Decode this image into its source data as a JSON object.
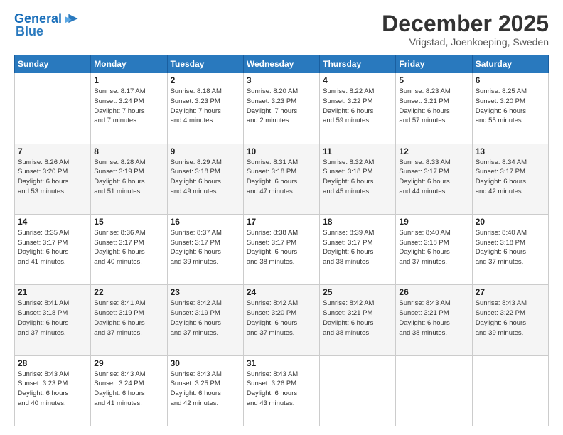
{
  "header": {
    "logo_line1": "General",
    "logo_line2": "Blue",
    "month_title": "December 2025",
    "location": "Vrigstad, Joenkoeping, Sweden"
  },
  "weekdays": [
    "Sunday",
    "Monday",
    "Tuesday",
    "Wednesday",
    "Thursday",
    "Friday",
    "Saturday"
  ],
  "weeks": [
    [
      {
        "day": "",
        "info": ""
      },
      {
        "day": "1",
        "info": "Sunrise: 8:17 AM\nSunset: 3:24 PM\nDaylight: 7 hours\nand 7 minutes."
      },
      {
        "day": "2",
        "info": "Sunrise: 8:18 AM\nSunset: 3:23 PM\nDaylight: 7 hours\nand 4 minutes."
      },
      {
        "day": "3",
        "info": "Sunrise: 8:20 AM\nSunset: 3:23 PM\nDaylight: 7 hours\nand 2 minutes."
      },
      {
        "day": "4",
        "info": "Sunrise: 8:22 AM\nSunset: 3:22 PM\nDaylight: 6 hours\nand 59 minutes."
      },
      {
        "day": "5",
        "info": "Sunrise: 8:23 AM\nSunset: 3:21 PM\nDaylight: 6 hours\nand 57 minutes."
      },
      {
        "day": "6",
        "info": "Sunrise: 8:25 AM\nSunset: 3:20 PM\nDaylight: 6 hours\nand 55 minutes."
      }
    ],
    [
      {
        "day": "7",
        "info": "Sunrise: 8:26 AM\nSunset: 3:20 PM\nDaylight: 6 hours\nand 53 minutes."
      },
      {
        "day": "8",
        "info": "Sunrise: 8:28 AM\nSunset: 3:19 PM\nDaylight: 6 hours\nand 51 minutes."
      },
      {
        "day": "9",
        "info": "Sunrise: 8:29 AM\nSunset: 3:18 PM\nDaylight: 6 hours\nand 49 minutes."
      },
      {
        "day": "10",
        "info": "Sunrise: 8:31 AM\nSunset: 3:18 PM\nDaylight: 6 hours\nand 47 minutes."
      },
      {
        "day": "11",
        "info": "Sunrise: 8:32 AM\nSunset: 3:18 PM\nDaylight: 6 hours\nand 45 minutes."
      },
      {
        "day": "12",
        "info": "Sunrise: 8:33 AM\nSunset: 3:17 PM\nDaylight: 6 hours\nand 44 minutes."
      },
      {
        "day": "13",
        "info": "Sunrise: 8:34 AM\nSunset: 3:17 PM\nDaylight: 6 hours\nand 42 minutes."
      }
    ],
    [
      {
        "day": "14",
        "info": "Sunrise: 8:35 AM\nSunset: 3:17 PM\nDaylight: 6 hours\nand 41 minutes."
      },
      {
        "day": "15",
        "info": "Sunrise: 8:36 AM\nSunset: 3:17 PM\nDaylight: 6 hours\nand 40 minutes."
      },
      {
        "day": "16",
        "info": "Sunrise: 8:37 AM\nSunset: 3:17 PM\nDaylight: 6 hours\nand 39 minutes."
      },
      {
        "day": "17",
        "info": "Sunrise: 8:38 AM\nSunset: 3:17 PM\nDaylight: 6 hours\nand 38 minutes."
      },
      {
        "day": "18",
        "info": "Sunrise: 8:39 AM\nSunset: 3:17 PM\nDaylight: 6 hours\nand 38 minutes."
      },
      {
        "day": "19",
        "info": "Sunrise: 8:40 AM\nSunset: 3:18 PM\nDaylight: 6 hours\nand 37 minutes."
      },
      {
        "day": "20",
        "info": "Sunrise: 8:40 AM\nSunset: 3:18 PM\nDaylight: 6 hours\nand 37 minutes."
      }
    ],
    [
      {
        "day": "21",
        "info": "Sunrise: 8:41 AM\nSunset: 3:18 PM\nDaylight: 6 hours\nand 37 minutes."
      },
      {
        "day": "22",
        "info": "Sunrise: 8:41 AM\nSunset: 3:19 PM\nDaylight: 6 hours\nand 37 minutes."
      },
      {
        "day": "23",
        "info": "Sunrise: 8:42 AM\nSunset: 3:19 PM\nDaylight: 6 hours\nand 37 minutes."
      },
      {
        "day": "24",
        "info": "Sunrise: 8:42 AM\nSunset: 3:20 PM\nDaylight: 6 hours\nand 37 minutes."
      },
      {
        "day": "25",
        "info": "Sunrise: 8:42 AM\nSunset: 3:21 PM\nDaylight: 6 hours\nand 38 minutes."
      },
      {
        "day": "26",
        "info": "Sunrise: 8:43 AM\nSunset: 3:21 PM\nDaylight: 6 hours\nand 38 minutes."
      },
      {
        "day": "27",
        "info": "Sunrise: 8:43 AM\nSunset: 3:22 PM\nDaylight: 6 hours\nand 39 minutes."
      }
    ],
    [
      {
        "day": "28",
        "info": "Sunrise: 8:43 AM\nSunset: 3:23 PM\nDaylight: 6 hours\nand 40 minutes."
      },
      {
        "day": "29",
        "info": "Sunrise: 8:43 AM\nSunset: 3:24 PM\nDaylight: 6 hours\nand 41 minutes."
      },
      {
        "day": "30",
        "info": "Sunrise: 8:43 AM\nSunset: 3:25 PM\nDaylight: 6 hours\nand 42 minutes."
      },
      {
        "day": "31",
        "info": "Sunrise: 8:43 AM\nSunset: 3:26 PM\nDaylight: 6 hours\nand 43 minutes."
      },
      {
        "day": "",
        "info": ""
      },
      {
        "day": "",
        "info": ""
      },
      {
        "day": "",
        "info": ""
      }
    ]
  ]
}
